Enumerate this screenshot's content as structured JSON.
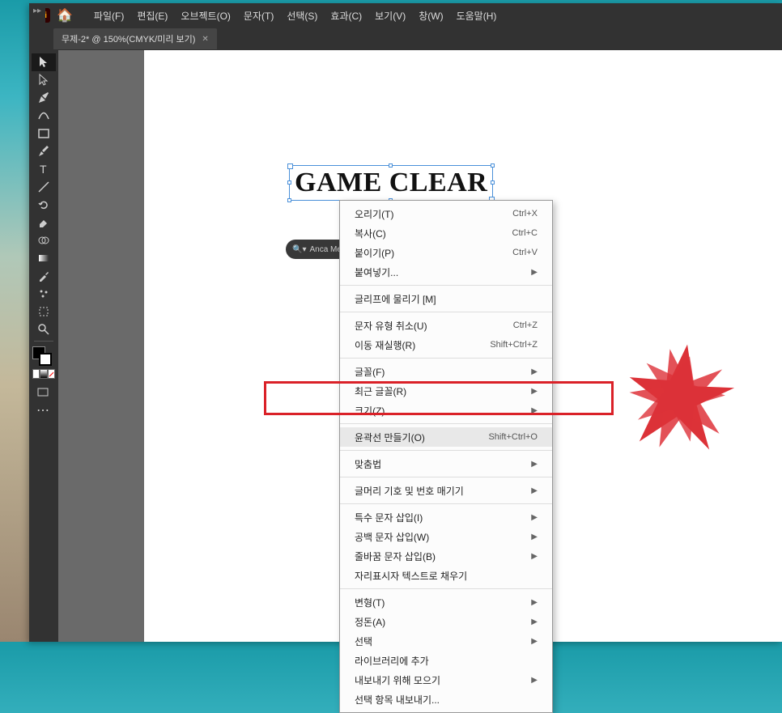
{
  "app": {
    "badge": "Ai",
    "tab_title": "무제-2* @ 150%(CMYK/미리 보기)"
  },
  "menu": {
    "file": "파일(F)",
    "edit": "편집(E)",
    "object": "오브젝트(O)",
    "text": "문자(T)",
    "select": "선택(S)",
    "effect": "효과(C)",
    "view": "보기(V)",
    "window": "창(W)",
    "help": "도움말(H)"
  },
  "canvas_text": "GAME CLEAR",
  "char_panel": {
    "font_name": "Anca Mediun"
  },
  "context_menu": {
    "undo": {
      "label": "오리기(T)",
      "shortcut": "Ctrl+X"
    },
    "copy": {
      "label": "복사(C)",
      "shortcut": "Ctrl+C"
    },
    "paste": {
      "label": "붙이기(P)",
      "shortcut": "Ctrl+V"
    },
    "paste_special": {
      "label": "붙여넣기..."
    },
    "snap_glyph": {
      "label": "글리프에 물리기 [M]"
    },
    "undo_type": {
      "label": "문자 유형 취소(U)",
      "shortcut": "Ctrl+Z"
    },
    "redo": {
      "label": "이동 재실행(R)",
      "shortcut": "Shift+Ctrl+Z"
    },
    "font": {
      "label": "글꼴(F)"
    },
    "recent_fonts": {
      "label": "최근 글꼴(R)"
    },
    "size": {
      "label": "크기(Z)"
    },
    "create_outlines": {
      "label": "윤곽선 만들기(O)",
      "shortcut": "Shift+Ctrl+O"
    },
    "spelling": {
      "label": "맞춤법"
    },
    "bullets": {
      "label": "글머리 기호 및 번호 매기기"
    },
    "insert_special": {
      "label": "특수 문자 삽입(I)"
    },
    "insert_whitespace": {
      "label": "공백 문자 삽입(W)"
    },
    "insert_break": {
      "label": "줄바꿈 문자 삽입(B)"
    },
    "fill_placeholder": {
      "label": "자리표시자 텍스트로 채우기"
    },
    "transform": {
      "label": "변형(T)"
    },
    "arrange": {
      "label": "정돈(A)"
    },
    "select2": {
      "label": "선택"
    },
    "add_library": {
      "label": "라이브러리에 추가"
    },
    "collect_export": {
      "label": "내보내기 위해 모으기"
    },
    "export_selection": {
      "label": "선택 항목 내보내기..."
    }
  }
}
